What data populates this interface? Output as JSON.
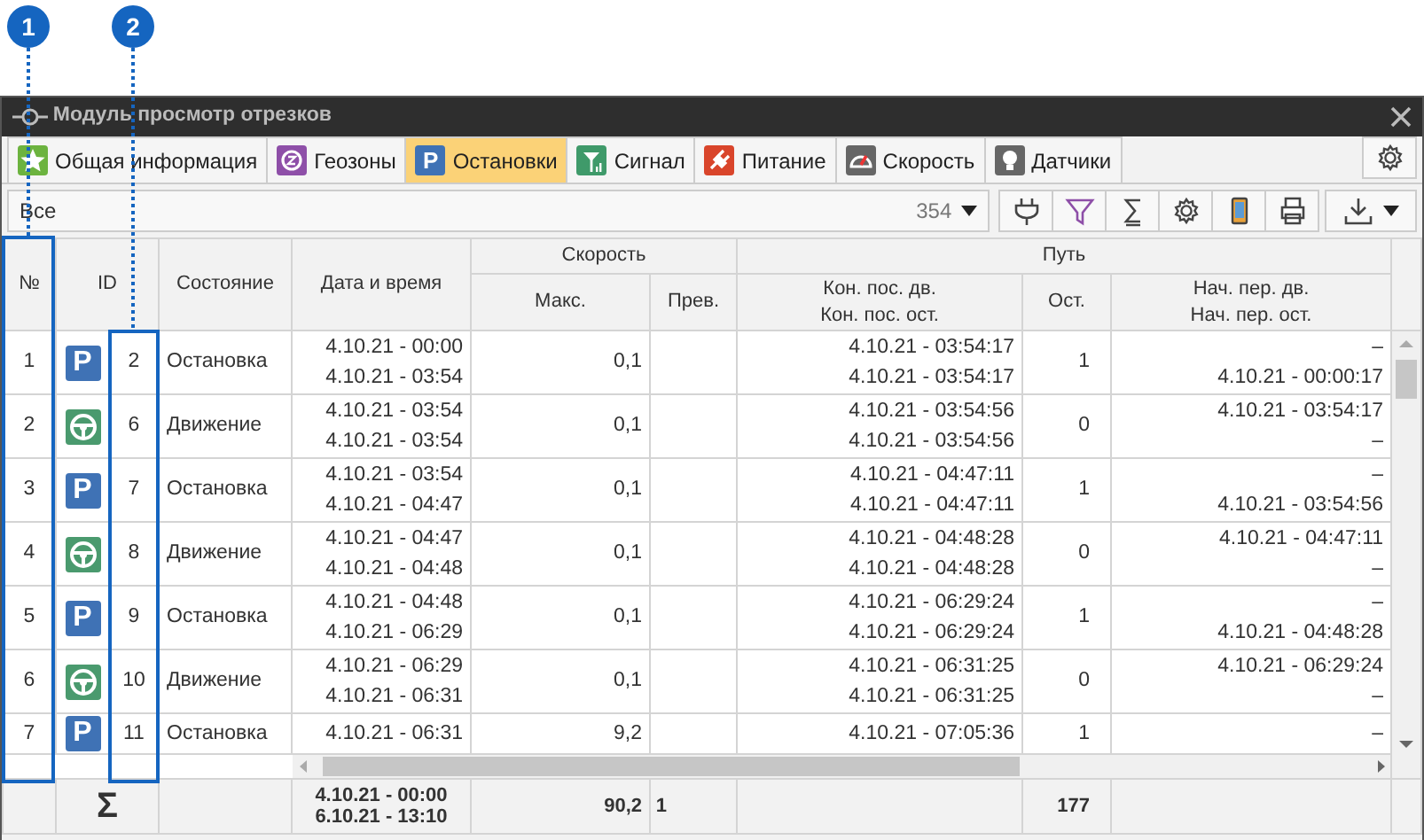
{
  "callouts": [
    {
      "label": "1"
    },
    {
      "label": "2"
    }
  ],
  "window": {
    "title": "Модуль просмотр отрезков"
  },
  "tabs": [
    {
      "label": "Общая информация",
      "selected": false,
      "color": "#6cb33f"
    },
    {
      "label": "Геозоны",
      "selected": false,
      "color": "#8e4fa8"
    },
    {
      "label": "Остановки",
      "selected": true,
      "color": "#3f72b5",
      "glyph": "P"
    },
    {
      "label": "Сигнал",
      "selected": false,
      "color": "#3f9a6a"
    },
    {
      "label": "Питание",
      "selected": false,
      "color": "#d9452b"
    },
    {
      "label": "Скорость",
      "selected": false,
      "color": "#666666"
    },
    {
      "label": "Датчики",
      "selected": false,
      "color": "#666666"
    }
  ],
  "filter": {
    "value": "Все",
    "count": "354"
  },
  "table": {
    "columns": {
      "num": "№",
      "id": "ID",
      "state": "Состояние",
      "datetime": "Дата и время",
      "speed": "Скорость",
      "speed_max": "Макс.",
      "speed_exceed": "Прев.",
      "path": "Путь",
      "path_end": [
        "Кон. пос. дв.",
        "Кон. пос. ост."
      ],
      "path_stops": "Ост.",
      "path_start": [
        "Нач. пер. дв.",
        "Нач. пер. ост."
      ]
    },
    "rows": [
      {
        "num": "1",
        "kind": "stop",
        "glyph": "P",
        "id": "2",
        "state": "Остановка",
        "datetime": [
          "4.10.21 - 00:00",
          "4.10.21 - 03:54"
        ],
        "max": "0,1",
        "end": [
          "4.10.21 - 03:54:17",
          "4.10.21 - 03:54:17"
        ],
        "stops": "1",
        "start": [
          "–",
          "4.10.21 - 00:00:17"
        ]
      },
      {
        "num": "2",
        "kind": "move",
        "id": "6",
        "state": "Движение",
        "datetime": [
          "4.10.21 - 03:54",
          "4.10.21 - 03:54"
        ],
        "max": "0,1",
        "end": [
          "4.10.21 - 03:54:56",
          "4.10.21 - 03:54:56"
        ],
        "stops": "0",
        "start": [
          "4.10.21 - 03:54:17",
          "–"
        ]
      },
      {
        "num": "3",
        "kind": "stop",
        "glyph": "P",
        "id": "7",
        "state": "Остановка",
        "datetime": [
          "4.10.21 - 03:54",
          "4.10.21 - 04:47"
        ],
        "max": "0,1",
        "end": [
          "4.10.21 - 04:47:11",
          "4.10.21 - 04:47:11"
        ],
        "stops": "1",
        "start": [
          "–",
          "4.10.21 - 03:54:56"
        ]
      },
      {
        "num": "4",
        "kind": "move",
        "id": "8",
        "state": "Движение",
        "datetime": [
          "4.10.21 - 04:47",
          "4.10.21 - 04:48"
        ],
        "max": "0,1",
        "end": [
          "4.10.21 - 04:48:28",
          "4.10.21 - 04:48:28"
        ],
        "stops": "0",
        "start": [
          "4.10.21 - 04:47:11",
          "–"
        ]
      },
      {
        "num": "5",
        "kind": "stop",
        "glyph": "P",
        "id": "9",
        "state": "Остановка",
        "datetime": [
          "4.10.21 - 04:48",
          "4.10.21 - 06:29"
        ],
        "max": "0,1",
        "end": [
          "4.10.21 - 06:29:24",
          "4.10.21 - 06:29:24"
        ],
        "stops": "1",
        "start": [
          "–",
          "4.10.21 - 04:48:28"
        ]
      },
      {
        "num": "6",
        "kind": "move",
        "id": "10",
        "state": "Движение",
        "datetime": [
          "4.10.21 - 06:29",
          "4.10.21 - 06:31"
        ],
        "max": "0,1",
        "end": [
          "4.10.21 - 06:31:25",
          "4.10.21 - 06:31:25"
        ],
        "stops": "0",
        "start": [
          "4.10.21 - 06:29:24",
          "–"
        ]
      },
      {
        "num": "7",
        "kind": "stop",
        "glyph": "P",
        "id": "11",
        "state": "Остановка",
        "datetime": [
          "4.10.21 - 06:31"
        ],
        "max": "9,2",
        "end": [
          "4.10.21 - 07:05:36"
        ],
        "stops": "1",
        "start": [
          "–"
        ]
      }
    ],
    "totals": {
      "sign": "Σ",
      "datetime": [
        "4.10.21 - 00:00",
        "6.10.21 - 13:10"
      ],
      "max": "90,2",
      "exceed": "1",
      "stops": "177"
    }
  }
}
